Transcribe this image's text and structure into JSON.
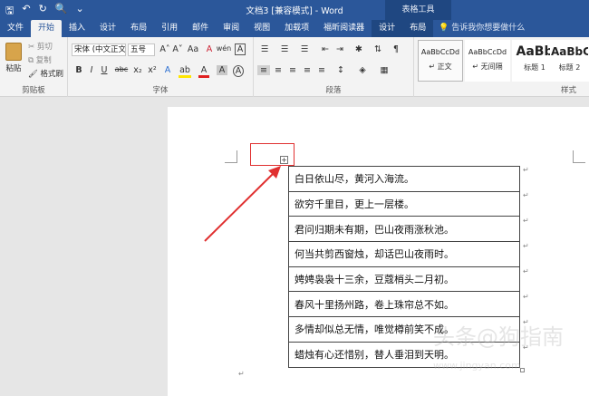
{
  "titlebar": {
    "title": "文档3 [兼容模式] - Word",
    "context_title": "表格工具",
    "qat_save": "🖫",
    "qat_undo": "↶",
    "qat_redo": "↻",
    "qat_preview": "🔍",
    "qat_more": "⌄"
  },
  "tabs": [
    {
      "label": "文件"
    },
    {
      "label": "开始"
    },
    {
      "label": "插入"
    },
    {
      "label": "设计"
    },
    {
      "label": "布局"
    },
    {
      "label": "引用"
    },
    {
      "label": "邮件"
    },
    {
      "label": "审阅"
    },
    {
      "label": "视图"
    },
    {
      "label": "加载项"
    },
    {
      "label": "福昕阅读器"
    },
    {
      "label": "设计"
    },
    {
      "label": "布局"
    }
  ],
  "tell_me": "告诉我你想要做什么",
  "ribbon": {
    "clipboard": {
      "label": "剪贴板",
      "paste": "粘贴",
      "cut": "剪切",
      "copy": "复制",
      "format_painter": "格式刷"
    },
    "font": {
      "label": "字体",
      "font_name": "宋体 (中文正文)",
      "font_size": "五号",
      "grow": "A˄",
      "shrink": "A˅",
      "case": "Aa",
      "clear": "A",
      "phonetic": "wén",
      "charborder": "A",
      "bold": "B",
      "italic": "I",
      "underline": "U",
      "strike": "abc",
      "subscript": "x₂",
      "superscript": "x²",
      "effects": "A",
      "highlight": "ab",
      "color": "A",
      "shade": "A",
      "enclose": "A"
    },
    "paragraph": {
      "label": "段落"
    },
    "styles": {
      "label": "样式",
      "items": [
        {
          "sample": "AaBbCcDd",
          "name": "↵ 正文"
        },
        {
          "sample": "AaBbCcDd",
          "name": "↵ 无间隔"
        },
        {
          "sample": "AaBb",
          "name": "标题 1"
        },
        {
          "sample": "AaBbC",
          "name": "标题 2"
        }
      ]
    }
  },
  "table": {
    "rows": [
      "白日依山尽，黄河入海流。",
      "欲穷千里目，更上一层楼。",
      "君问归期未有期，巴山夜雨涨秋池。",
      "何当共剪西窗烛，却话巴山夜雨时。",
      "娉娉袅袅十三余，豆蔻梢头二月初。",
      "春风十里扬州路，卷上珠帘总不如。",
      "多情却似总无情，唯觉樽前笑不成。",
      "蜡烛有心还惜别，替人垂泪到天明。"
    ]
  },
  "marks": {
    "paragraph": "↵",
    "move_handle": "+"
  },
  "watermark": "头条@狗指南",
  "colors": {
    "accent": "#2b579a",
    "highlight_box": "#e03030"
  }
}
